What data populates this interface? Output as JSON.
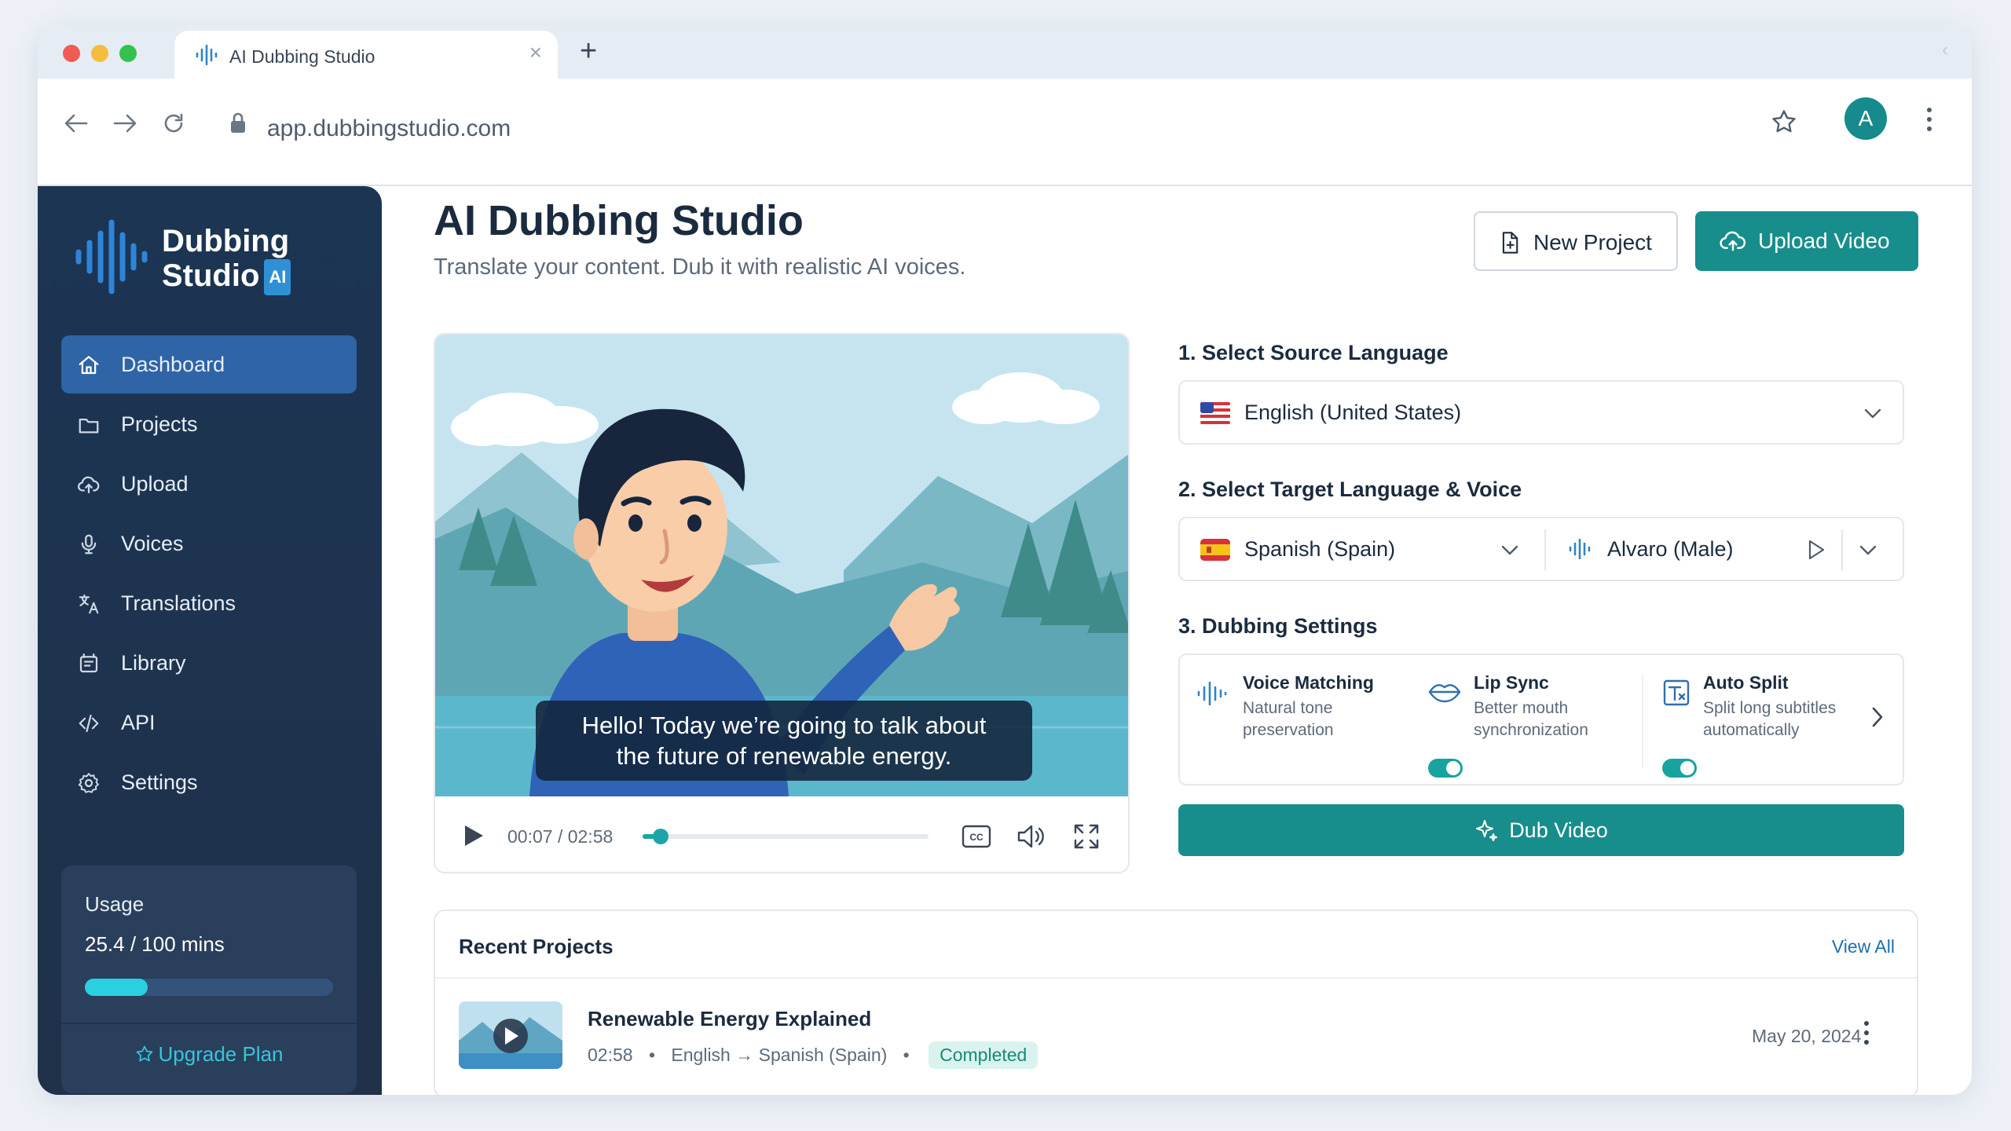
{
  "browser": {
    "tab_title": "AI Dubbing Studio",
    "url": "app.dubbingstudio.com",
    "avatar_letter": "A"
  },
  "sidebar": {
    "brand_line1": "Dubbing",
    "brand_line2": "Studio",
    "brand_badge": "AI",
    "items": [
      {
        "label": "Dashboard",
        "icon": "home-icon",
        "active": true
      },
      {
        "label": "Projects",
        "icon": "folder-icon"
      },
      {
        "label": "Upload",
        "icon": "cloud-upload-icon"
      },
      {
        "label": "Voices",
        "icon": "microphone-icon"
      },
      {
        "label": "Translations",
        "icon": "translate-icon"
      },
      {
        "label": "Library",
        "icon": "library-icon"
      },
      {
        "label": "API",
        "icon": "code-icon"
      },
      {
        "label": "Settings",
        "icon": "gear-icon"
      }
    ],
    "usage": {
      "label": "Usage",
      "used": "25.4",
      "total_text": "/ 100 mins",
      "fraction": 0.254,
      "upgrade_label": "Upgrade Plan"
    }
  },
  "header": {
    "title": "AI Dubbing Studio",
    "subtitle": "Translate your content. Dub it with realistic AI voices.",
    "new_project_label": "New Project",
    "upload_video_label": "Upload Video"
  },
  "player": {
    "subtitle_line1": "Hello! Today we’re going to talk about",
    "subtitle_line2": "the future of renewable energy.",
    "time": "00:07 / 02:58",
    "progress_fraction": 0.04
  },
  "config": {
    "source_title": "1. Select Source Language",
    "source_language": "English (United States)",
    "target_title": "2. Select Target Language & Voice",
    "target_language": "Spanish (Spain)",
    "voice": "Alvaro (Male)",
    "settings_title": "3. Dubbing Settings",
    "features": [
      {
        "title": "Voice Matching",
        "desc1": "Natural tone",
        "desc2": "preservation",
        "enabled": null
      },
      {
        "title": "Lip Sync",
        "desc1": "Better mouth",
        "desc2": "synchronization",
        "enabled": true
      },
      {
        "title": "Auto Split",
        "desc1": "Split long subtitles",
        "desc2": "automatically",
        "enabled": true
      }
    ],
    "dub_button_label": "Dub Video"
  },
  "recent": {
    "title": "Recent Projects",
    "view_all": "View All",
    "rows": [
      {
        "name": "Renewable Energy Explained",
        "duration": "02:58",
        "languages": "English → Spanish (Spain)",
        "status": "Completed",
        "date": "May 20, 2024"
      }
    ]
  },
  "colors": {
    "accent": "#178e8c",
    "sidebar": "#1b3553",
    "active_nav": "#2f64a6",
    "usage_fill": "#2ad0e0"
  }
}
